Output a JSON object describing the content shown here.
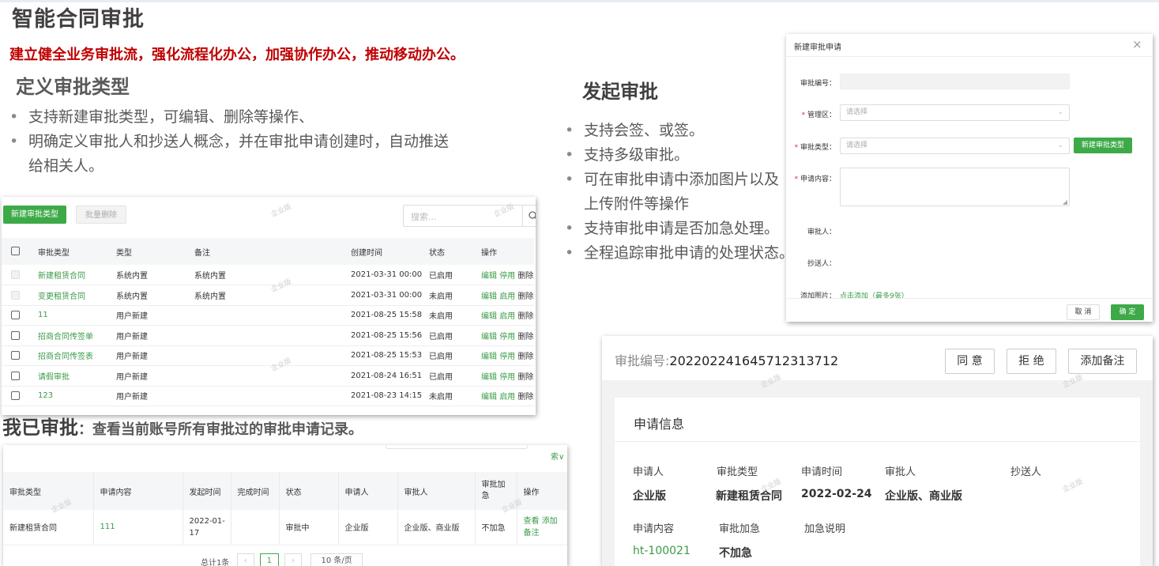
{
  "header": {
    "title": "智能合同审批",
    "slogan": "建立健全业务审批流，强化流程化办公，加强协作办公，推动移动办公。"
  },
  "define_section": {
    "title": "定义审批类型",
    "bullets": [
      "支持新建审批类型，可编辑、删除等操作、",
      "明确定义审批人和抄送人概念，并在审批申请创建时，自动推送给相关人。"
    ],
    "bullet2_line1": "明确定义审批人和抄送人概念，并在审批申请创建时，自动推送",
    "bullet2_line2": "给相关人。"
  },
  "type_table": {
    "new_button": "新建审批类型",
    "batch_delete_button": "批量删除",
    "search_placeholder": "搜索...",
    "columns": [
      "审批类型",
      "类型",
      "备注",
      "创建时间",
      "状态",
      "操作"
    ],
    "rows": [
      {
        "name": "新建租赁合同",
        "kind": "系统内置",
        "note": "系统内置",
        "created": "2021-03-31 00:00",
        "status": "已启用",
        "a1": "编辑",
        "a2": "停用",
        "a3": "删除",
        "disabled": true
      },
      {
        "name": "变更租赁合同",
        "kind": "系统内置",
        "note": "系统内置",
        "created": "2021-03-31 00:00",
        "status": "未启用",
        "a1": "编辑",
        "a2": "启用",
        "a3": "删除",
        "disabled": true
      },
      {
        "name": "11",
        "kind": "用户新建",
        "note": "",
        "created": "2021-08-25 15:58",
        "status": "未启用",
        "a1": "编辑",
        "a2": "启用",
        "a3": "删除",
        "disabled": false
      },
      {
        "name": "招商合同传签单",
        "kind": "用户新建",
        "note": "",
        "created": "2021-08-25 15:56",
        "status": "已启用",
        "a1": "编辑",
        "a2": "停用",
        "a3": "删除",
        "disabled": false
      },
      {
        "name": "招商合同传签表",
        "kind": "用户新建",
        "note": "",
        "created": "2021-08-25 15:53",
        "status": "已启用",
        "a1": "编辑",
        "a2": "停用",
        "a3": "删除",
        "disabled": false
      },
      {
        "name": "请假审批",
        "kind": "用户新建",
        "note": "",
        "created": "2021-08-24 16:51",
        "status": "已启用",
        "a1": "编辑",
        "a2": "停用",
        "a3": "删除",
        "disabled": false
      },
      {
        "name": "123",
        "kind": "用户新建",
        "note": "",
        "created": "2021-08-23 14:15",
        "status": "未启用",
        "a1": "编辑",
        "a2": "启用",
        "a3": "删除",
        "disabled": false
      }
    ]
  },
  "approved_section": {
    "title": "我已审批",
    "colon": "：",
    "desc": "查看当前账号所有审批过的审批申请记录。"
  },
  "approved_table": {
    "search_fragment": "索",
    "columns": [
      "审批类型",
      "申请内容",
      "发起时间",
      "完成时间",
      "状态",
      "申请人",
      "审批人",
      "审批加急",
      "操作"
    ],
    "urgent_line1": "审批加",
    "urgent_line2": "急",
    "row": {
      "type": "新建租赁合同",
      "content": "111",
      "start_l1": "2022-01-",
      "start_l2": "17",
      "finish": "",
      "status": "审批中",
      "applicant": "企业版",
      "approver": "企业版、商业版",
      "urgent": "不加急",
      "op_view": "查看",
      "op_add": "添加",
      "op_note": "备注"
    },
    "pager": {
      "total": "总计1条",
      "prev": "‹",
      "page": "1",
      "next": "›",
      "size": "10 条/页"
    }
  },
  "launch_section": {
    "title": "发起审批",
    "bullets": [
      "支持会签、或签。",
      "支持多级审批。",
      "可在审批申请中添加图片以及",
      "上传附件等操作",
      "支持审批申请是否加急处理。",
      "全程追踪审批申请的处理状态。"
    ]
  },
  "dialog": {
    "title": "新建审批申请",
    "close": "×",
    "fields": {
      "number": "审批编号：",
      "area": "管理区：",
      "area_placeholder": "请选择",
      "type": "审批类型：",
      "type_placeholder": "请选择",
      "new_type_button": "新建审批类型",
      "content": "申请内容：",
      "approver": "审批人：",
      "cc": "抄送人：",
      "images": "添加图片：",
      "images_link": "点击添加（最多9张）"
    },
    "cancel": "取 消",
    "confirm": "确 定"
  },
  "detail": {
    "number_label": "审批编号:",
    "number_value": "20220224164571231371 2",
    "number_full": "202202241645712313712",
    "agree": "同 意",
    "reject": "拒 绝",
    "add_note": "添加备注",
    "section_title": "申请信息",
    "labels": [
      "申请人",
      "审批类型",
      "申请时间",
      "审批人",
      "抄送人"
    ],
    "values": [
      "企业版",
      "新建租赁合同",
      "2022-02-24",
      "企业版、商业版",
      ""
    ],
    "labels2": [
      "申请内容",
      "审批加急",
      "加急说明"
    ],
    "values2": [
      "ht-100021",
      "不加急",
      ""
    ]
  },
  "watermark": "企业版",
  "colors": {
    "accent_green": "#3daa47",
    "slogan_red": "#c00000",
    "link_green": "#3b9b47"
  }
}
